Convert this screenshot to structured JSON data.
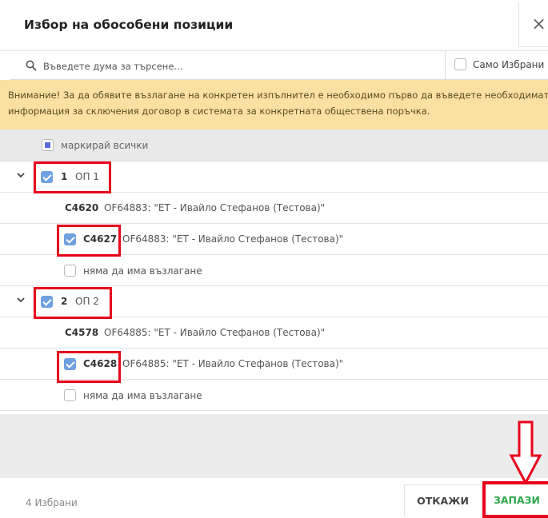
{
  "dialog": {
    "title": "Избор на обособени позиции",
    "close": "×"
  },
  "search": {
    "placeholder": "Въведете дума за търсене...",
    "value": "",
    "only_selected_label": "Само Избрани",
    "only_selected_checked": false
  },
  "warning": {
    "line1": "Внимание! За да обявите възлагане на конкретен изпълнител е необходимо първо да въведете необходимата",
    "line2": "информация за сключения договор в системата за конкретната обществена поръчка."
  },
  "mark_all": {
    "label": "маркирай всички",
    "state": "partial"
  },
  "groups": [
    {
      "number": "1",
      "name": "ОП 1",
      "checked": true,
      "expanded": true,
      "items": [
        {
          "code": "C4620",
          "text": "OF64883: \"ЕТ - Ивайло Стефанов (Тестова)\"",
          "checkbox": false
        },
        {
          "code": "C4627",
          "text": "OF64883: \"ЕТ - Ивайло Стефанов (Тестова)\"",
          "checkbox": true,
          "checked": true
        }
      ],
      "no_award_label": "няма да има възлагане",
      "no_award_checked": false
    },
    {
      "number": "2",
      "name": "ОП 2",
      "checked": true,
      "expanded": true,
      "items": [
        {
          "code": "C4578",
          "text": "OF64885: \"ЕТ - Ивайло Стефанов (Тестова)\"",
          "checkbox": false
        },
        {
          "code": "C4628",
          "text": "OF64885: \"ЕТ - Ивайло Стефанов (Тестова)\"",
          "checkbox": true,
          "checked": true
        }
      ],
      "no_award_label": "няма да има възлагане",
      "no_award_checked": false
    }
  ],
  "footer": {
    "selected_count": "4 Избрани",
    "cancel_label": "ОТКАЖИ",
    "save_label": "ЗАПАЗИ"
  },
  "colors": {
    "warning_bg": "#fbe0a3",
    "checkbox_checked": "#6fa0e0",
    "save_text": "#2da84a",
    "highlight": "#e8001c"
  }
}
